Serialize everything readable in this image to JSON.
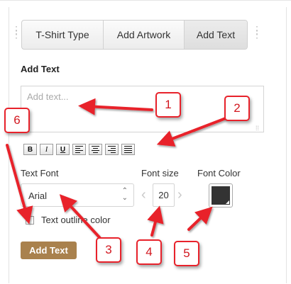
{
  "tabs": [
    {
      "label": "T-Shirt Type",
      "active": false
    },
    {
      "label": "Add Artwork",
      "active": false
    },
    {
      "label": "Add Text",
      "active": true
    }
  ],
  "section_title": "Add Text",
  "text_input": {
    "placeholder": "Add text..."
  },
  "formatting": {
    "bold": "B",
    "italic": "I",
    "underline": "U",
    "align_buttons": [
      "align-left",
      "align-center",
      "align-right",
      "align-justify"
    ]
  },
  "text_font": {
    "label": "Text Font",
    "value": "Arial"
  },
  "font_size": {
    "label": "Font size",
    "value": "20"
  },
  "font_color": {
    "label": "Font Color",
    "value": "#333333"
  },
  "outline": {
    "label": "Text outline color",
    "checked": false
  },
  "add_button": {
    "label": "Add Text",
    "color": "#a9814d"
  },
  "callouts": [
    "1",
    "2",
    "3",
    "4",
    "5",
    "6"
  ],
  "annotation_color": "#e8222b"
}
